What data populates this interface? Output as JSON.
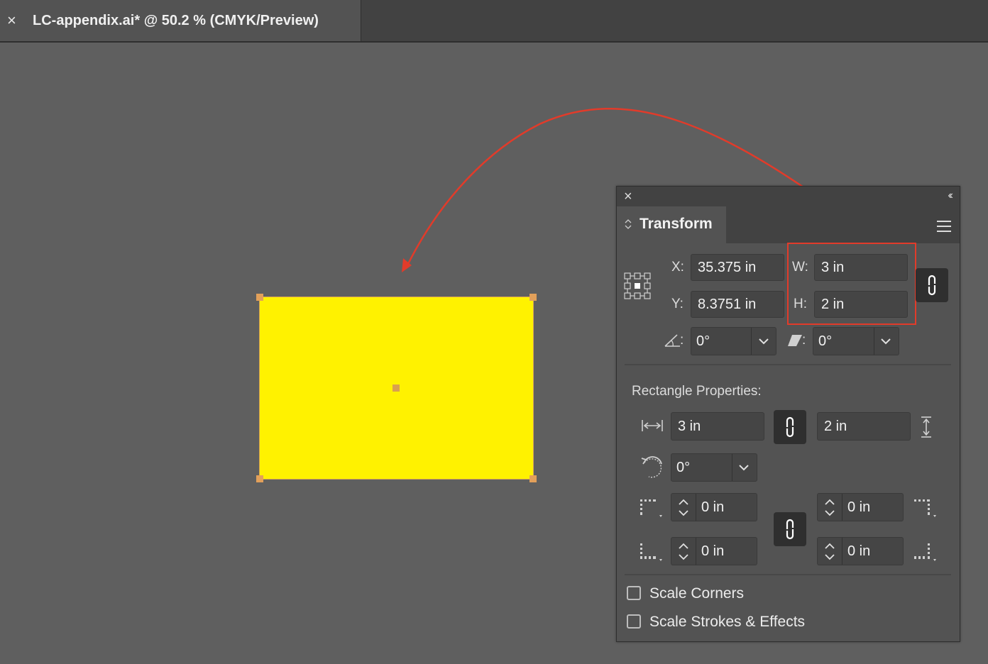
{
  "document_tab": {
    "close_glyph": "×",
    "title": "LC-appendix.ai* @ 50.2 % (CMYK/Preview)"
  },
  "canvas": {
    "rect_fill": "#fff200",
    "annotation_color": "#e23b2a"
  },
  "panel": {
    "close_glyph": "×",
    "collapse_glyph": "‹‹",
    "tab_label": "Transform",
    "x_label": "X:",
    "x_value": "35.375 in",
    "y_label": "Y:",
    "y_value": "8.3751 in",
    "w_label": "W:",
    "w_value": "3 in",
    "h_label": "H:",
    "h_value": "2 in",
    "rotate_colon": ":",
    "rotate_value": "0°",
    "shear_colon": ":",
    "shear_value": "0°",
    "rect_props_label": "Rectangle Properties:",
    "rect_width": "3 in",
    "rect_height": "2 in",
    "rect_rotation": "0°",
    "corner_tl": "0 in",
    "corner_tr": "0 in",
    "corner_bl": "0 in",
    "corner_br": "0 in",
    "scale_corners_label": "Scale Corners",
    "scale_strokes_label": "Scale Strokes & Effects"
  }
}
